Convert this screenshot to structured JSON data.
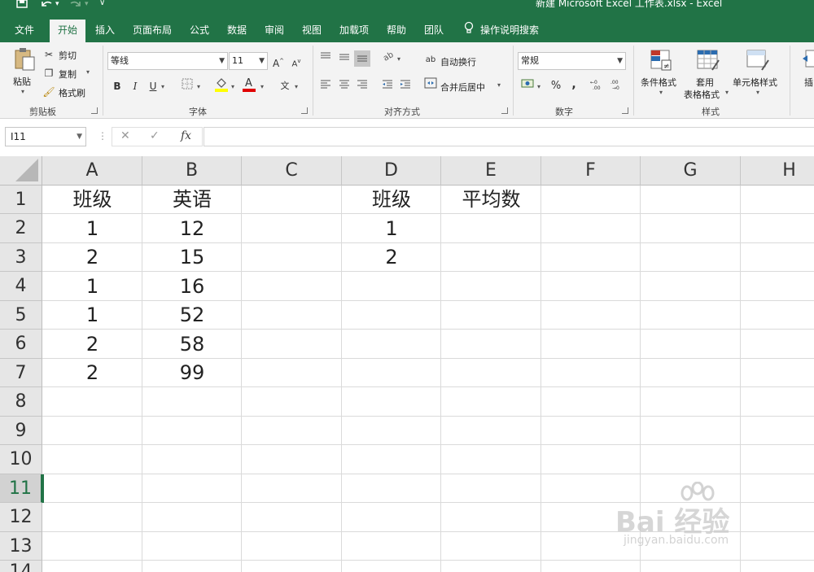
{
  "window": {
    "title": "新建 Microsoft Excel 工作表.xlsx  -  Excel"
  },
  "quick_access": {
    "save_icon": "save-icon",
    "undo_icon": "undo-icon",
    "redo_icon": "redo-icon",
    "customize_icon": "chevron-down-icon"
  },
  "tabs": [
    {
      "label": "文件"
    },
    {
      "label": "开始",
      "active": true
    },
    {
      "label": "插入"
    },
    {
      "label": "页面布局"
    },
    {
      "label": "公式"
    },
    {
      "label": "数据"
    },
    {
      "label": "审阅"
    },
    {
      "label": "视图"
    },
    {
      "label": "加载项"
    },
    {
      "label": "帮助"
    },
    {
      "label": "团队"
    }
  ],
  "tell_me": "操作说明搜索",
  "ribbon": {
    "clipboard": {
      "label": "剪贴板",
      "paste": "粘贴",
      "cut": "剪切",
      "copy": "复制",
      "format_painter": "格式刷"
    },
    "font": {
      "label": "字体",
      "font_name": "等线",
      "font_size": "11",
      "bold": "B",
      "italic": "I",
      "underline": "U",
      "grow": "A",
      "shrink": "A",
      "phonetic": "文"
    },
    "alignment": {
      "label": "对齐方式",
      "wrap_text": "自动换行",
      "merge_center": "合并后居中"
    },
    "number": {
      "label": "数字",
      "format": "常规",
      "percent": "%",
      "comma": ","
    },
    "styles": {
      "label": "样式",
      "conditional": "条件格式",
      "format_table_1": "套用",
      "format_table_2": "表格格式",
      "cell_styles": "单元格样式"
    },
    "cells": {
      "insert": "插"
    }
  },
  "formula_bar": {
    "name_box": "I11",
    "fx": "fx",
    "formula": ""
  },
  "sheet": {
    "columns": [
      "A",
      "B",
      "C",
      "D",
      "E",
      "F",
      "G",
      "H"
    ],
    "rows": [
      "1",
      "2",
      "3",
      "4",
      "5",
      "6",
      "7",
      "8",
      "9",
      "10",
      "11",
      "12",
      "13",
      "14"
    ],
    "selected_row": "11",
    "cells": {
      "A1": "班级",
      "B1": "英语",
      "D1": "班级",
      "E1": "平均数",
      "A2": "1",
      "B2": "12",
      "D2": "1",
      "A3": "2",
      "B3": "15",
      "D3": "2",
      "A4": "1",
      "B4": "16",
      "A5": "1",
      "B5": "52",
      "A6": "2",
      "B6": "58",
      "A7": "2",
      "B7": "99"
    }
  },
  "watermark": {
    "main": "Bai 经验",
    "sub": "jingyan.baidu.com"
  }
}
